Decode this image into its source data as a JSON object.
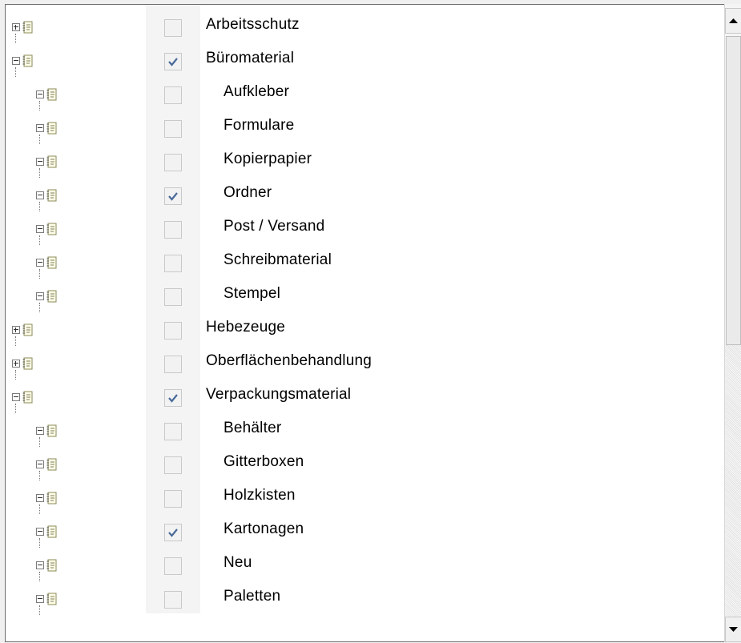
{
  "tree": {
    "rows": [
      {
        "label": "Arbeitsschutz",
        "level": 0,
        "expander": "plus",
        "checked": false
      },
      {
        "label": "Büromaterial",
        "level": 0,
        "expander": "minus",
        "checked": true
      },
      {
        "label": "Aufkleber",
        "level": 1,
        "expander": "minus",
        "checked": false
      },
      {
        "label": "Formulare",
        "level": 1,
        "expander": "minus",
        "checked": false
      },
      {
        "label": "Kopierpapier",
        "level": 1,
        "expander": "minus",
        "checked": false
      },
      {
        "label": "Ordner",
        "level": 1,
        "expander": "minus",
        "checked": true
      },
      {
        "label": "Post / Versand",
        "level": 1,
        "expander": "minus",
        "checked": false
      },
      {
        "label": "Schreibmaterial",
        "level": 1,
        "expander": "minus",
        "checked": false
      },
      {
        "label": "Stempel",
        "level": 1,
        "expander": "minus",
        "checked": false
      },
      {
        "label": "Hebezeuge",
        "level": 0,
        "expander": "plus",
        "checked": false
      },
      {
        "label": "Oberflächenbehandlung",
        "level": 0,
        "expander": "plus",
        "checked": false
      },
      {
        "label": "Verpackungsmaterial",
        "level": 0,
        "expander": "minus",
        "checked": true
      },
      {
        "label": "Behälter",
        "level": 1,
        "expander": "minus",
        "checked": false
      },
      {
        "label": "Gitterboxen",
        "level": 1,
        "expander": "minus",
        "checked": false
      },
      {
        "label": "Holzkisten",
        "level": 1,
        "expander": "minus",
        "checked": false
      },
      {
        "label": "Kartonagen",
        "level": 1,
        "expander": "minus",
        "checked": true
      },
      {
        "label": "Neu",
        "level": 1,
        "expander": "minus",
        "checked": false
      },
      {
        "label": "Paletten",
        "level": 1,
        "expander": "minus",
        "checked": false
      }
    ]
  },
  "icons": {
    "node": "note-icon",
    "checkmark": "checkmark-icon",
    "scroll_up": "arrow-up-icon",
    "scroll_down": "arrow-down-icon"
  },
  "colors": {
    "checkmark": "#4a6a9a",
    "icon_border": "#8a8a5a",
    "icon_fill": "#fffde8",
    "checkbox_column": "#f4f4f4"
  }
}
